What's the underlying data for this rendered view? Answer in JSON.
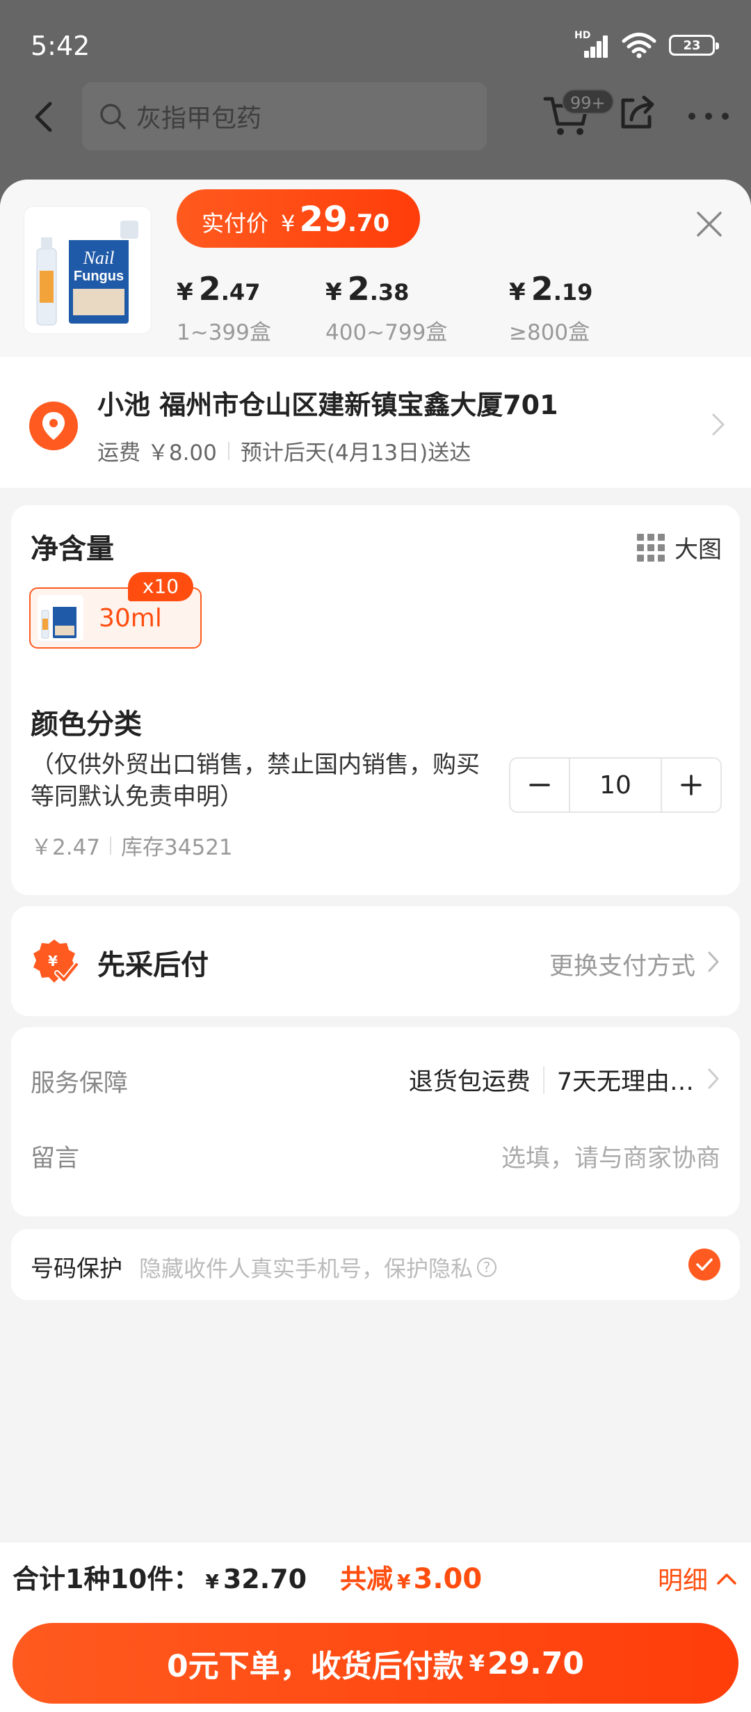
{
  "status_bar": {
    "time": "5:42",
    "network_badge": "HD",
    "battery": "23"
  },
  "nav": {
    "search_placeholder": "灰指甲包药",
    "cart_badge": "99+"
  },
  "product": {
    "real_price_label": "实付价",
    "currency": "¥",
    "real_price_int": "29",
    "real_price_dec": ".70",
    "tiers": [
      {
        "currency": "¥",
        "int": "2",
        "dec": ".47",
        "range": "1~399盒"
      },
      {
        "currency": "¥",
        "int": "2",
        "dec": ".38",
        "range": "400~799盒"
      },
      {
        "currency": "¥",
        "int": "2",
        "dec": ".19",
        "range": "≥800盒"
      }
    ],
    "thumb_brand_line1": "Nail",
    "thumb_brand_line2": "Fungus"
  },
  "address": {
    "line": "小池 福州市仓山区建新镇宝鑫大厦701",
    "shipping": "运费 ￥8.00",
    "eta": "预计后天(4月13日)送达"
  },
  "spec": {
    "title": "净含量",
    "big_image_label": "大图",
    "option_label": "30ml",
    "option_badge": "x10",
    "color_title": "颜色分类",
    "color_desc": "（仅供外贸出口销售，禁止国内销售，购买等同默认免责申明）",
    "unit_price": "￥2.47",
    "stock": "库存34521",
    "quantity": "10"
  },
  "payment": {
    "title": "先采后付",
    "change_label": "更换支付方式"
  },
  "service": {
    "label": "服务保障",
    "item1": "退货包运费",
    "item2": "7天无理由…",
    "message_label": "留言",
    "message_placeholder": "选填，请与商家协商"
  },
  "privacy": {
    "label": "号码保护",
    "desc": "隐藏收件人真实手机号，保护隐私",
    "help": "?",
    "checked": true
  },
  "bottom": {
    "total_label": "合计1种10件：",
    "currency": "¥",
    "total_amount": "32.70",
    "discount_label": "共减",
    "discount_amount": "3.00",
    "detail_label": "明细",
    "submit_label": "0元下单，收货后付款",
    "submit_amount": "29.70"
  },
  "colors": {
    "accent": "#ff5a1f",
    "accent_dark": "#ff3d0a"
  }
}
